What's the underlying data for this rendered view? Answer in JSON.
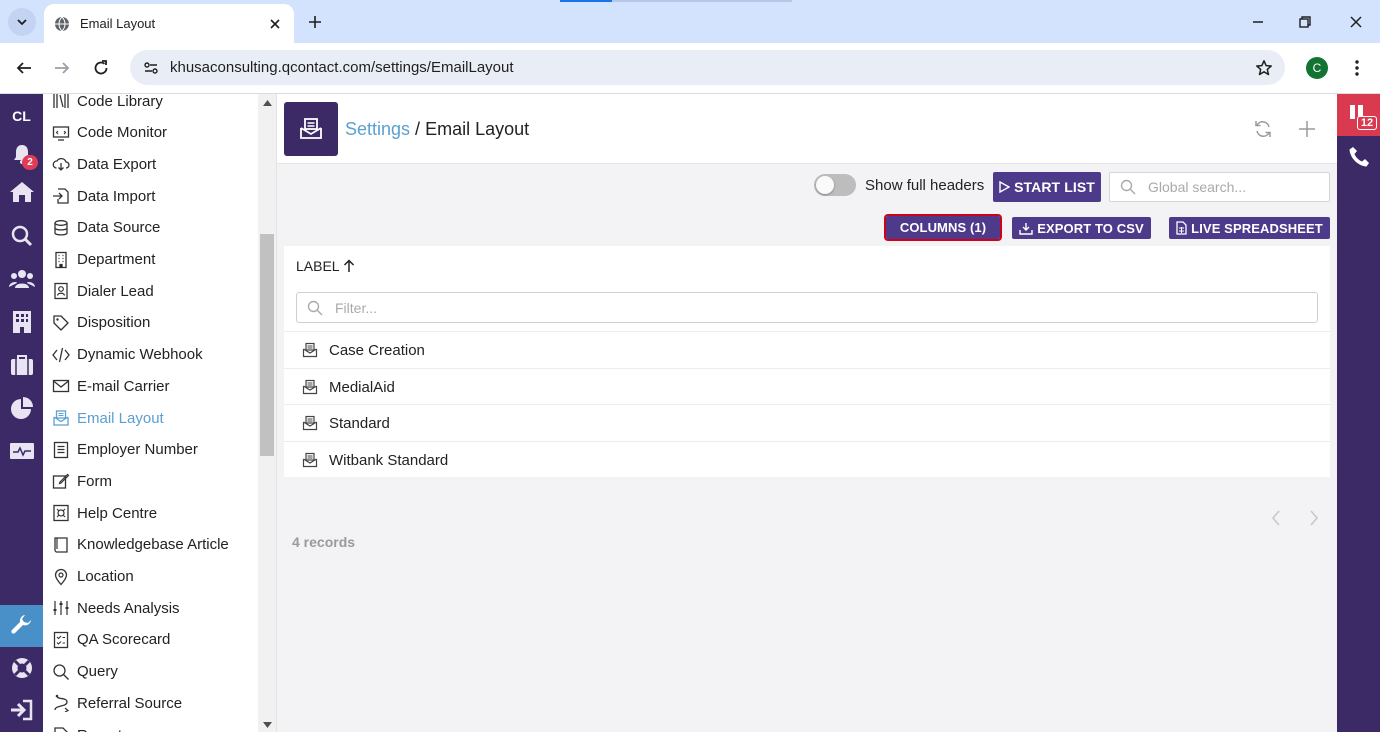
{
  "browser": {
    "tab_title": "Email Layout",
    "url": "khusaconsulting.qcontact.com/settings/EmailLayout",
    "profile_initial": "C"
  },
  "rail": {
    "user_initials": "CL",
    "notification_count": "2",
    "icons": [
      "bell-icon",
      "home-icon",
      "search-icon",
      "users-icon",
      "building-icon",
      "briefcase-icon",
      "pie-chart-icon",
      "monitor-icon",
      "wrench-icon",
      "lifebuoy-icon",
      "logout-icon"
    ]
  },
  "sidebar": {
    "items": [
      {
        "label": "Code Library",
        "icon": "library-icon"
      },
      {
        "label": "Code Monitor",
        "icon": "code-monitor-icon"
      },
      {
        "label": "Data Export",
        "icon": "download-cloud-icon"
      },
      {
        "label": "Data Import",
        "icon": "import-icon"
      },
      {
        "label": "Data Source",
        "icon": "database-icon"
      },
      {
        "label": "Department",
        "icon": "building-icon"
      },
      {
        "label": "Dialer Lead",
        "icon": "contact-card-icon"
      },
      {
        "label": "Disposition",
        "icon": "tag-icon"
      },
      {
        "label": "Dynamic Webhook",
        "icon": "code-icon"
      },
      {
        "label": "E-mail Carrier",
        "icon": "envelope-icon"
      },
      {
        "label": "Email Layout",
        "icon": "email-layout-icon",
        "active": true
      },
      {
        "label": "Employer Number",
        "icon": "list-icon"
      },
      {
        "label": "Form",
        "icon": "form-edit-icon"
      },
      {
        "label": "Help Centre",
        "icon": "help-centre-icon"
      },
      {
        "label": "Knowledgebase Article",
        "icon": "book-icon"
      },
      {
        "label": "Location",
        "icon": "map-pin-icon"
      },
      {
        "label": "Needs Analysis",
        "icon": "sliders-icon"
      },
      {
        "label": "QA Scorecard",
        "icon": "scorecard-icon"
      },
      {
        "label": "Query",
        "icon": "search-icon"
      },
      {
        "label": "Referral Source",
        "icon": "route-icon"
      },
      {
        "label": "Report",
        "icon": "report-icon"
      }
    ]
  },
  "header": {
    "breadcrumb_link": "Settings",
    "breadcrumb_sep": " / ",
    "page_title": "Email Layout"
  },
  "toolbar": {
    "toggle_label": "Show full headers",
    "start_list": "START LIST",
    "search_placeholder": "Global search...",
    "columns": "COLUMNS (1)",
    "export_csv": "EXPORT TO CSV",
    "live_spreadsheet": "LIVE SPREADSHEET"
  },
  "table": {
    "column_header": "LABEL",
    "filter_placeholder": "Filter...",
    "rows": [
      "Case Creation",
      "MedialAid",
      "Standard",
      "Witbank Standard"
    ]
  },
  "footer": {
    "records": "4 records"
  },
  "right_rail": {
    "badge_count": "12"
  },
  "colors": {
    "brand_purple": "#3b2a66",
    "button_purple": "#4e3a8a",
    "link_blue": "#5aa0d0",
    "alert_red": "#d93a4f"
  }
}
